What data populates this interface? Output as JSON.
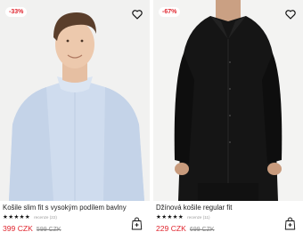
{
  "products": [
    {
      "discount_badge": "-33%",
      "name": "Košile slim fit s vysokým podílem bavlny",
      "stars": "★★★★★",
      "reviews": "recenze (22)",
      "price": "399 CZK",
      "old_price": "599 CZK",
      "image_subject": "man in light blue shirt",
      "wishlist_icon": "heart-icon",
      "cart_icon": "shopping-bag-plus-icon"
    },
    {
      "discount_badge": "-67%",
      "name": "Džínová košile regular fit",
      "stars": "★★★★★",
      "reviews": "recenze (11)",
      "price": "229 CZK",
      "old_price": "699 CZK",
      "image_subject": "man in black denim shirt",
      "wishlist_icon": "heart-icon",
      "cart_icon": "shopping-bag-plus-icon"
    }
  ],
  "colors": {
    "sale_red": "#e0252e",
    "text": "#222222",
    "muted": "#888888",
    "image_bg": "#f1f1f0"
  }
}
